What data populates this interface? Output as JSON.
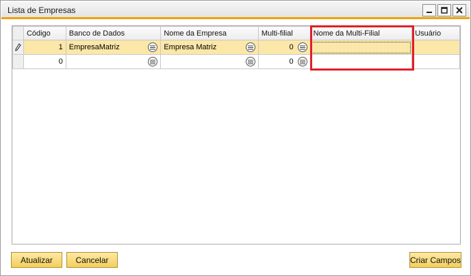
{
  "window": {
    "title": "Lista de Empresas"
  },
  "grid": {
    "columns": [
      "",
      "Código",
      "Banco de Dados",
      "Nome da Empresa",
      "Multi-filial",
      "Nome da Multi-Filial",
      "Usuário"
    ],
    "rows": [
      {
        "codigo": "1",
        "banco": "EmpresaMatriz",
        "nome": "Empresa Matriz",
        "multifilial": "0",
        "nome_multifilial": "",
        "usuario": ""
      },
      {
        "codigo": "0",
        "banco": "",
        "nome": "",
        "multifilial": "0",
        "nome_multifilial": "",
        "usuario": ""
      }
    ]
  },
  "buttons": {
    "atualizar": "Atualizar",
    "cancelar": "Cancelar",
    "criar_campos": "Criar Campos"
  },
  "colors": {
    "accent": "#f0a30a",
    "active_row": "#fbe7a8",
    "highlight": "#e01f26",
    "button": "#f4cf5b"
  }
}
